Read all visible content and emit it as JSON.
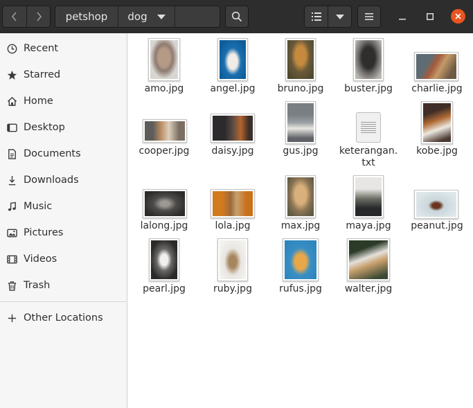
{
  "header": {
    "path": [
      "petshop",
      "dog"
    ],
    "colors": {
      "bar": "#2d2d2d",
      "close": "#e95420"
    }
  },
  "sidebar": {
    "items": [
      {
        "label": "Recent",
        "icon": "clock-icon"
      },
      {
        "label": "Starred",
        "icon": "star-icon"
      },
      {
        "label": "Home",
        "icon": "home-icon"
      },
      {
        "label": "Desktop",
        "icon": "desktop-icon"
      },
      {
        "label": "Documents",
        "icon": "document-icon"
      },
      {
        "label": "Downloads",
        "icon": "download-icon"
      },
      {
        "label": "Music",
        "icon": "music-icon"
      },
      {
        "label": "Pictures",
        "icon": "picture-icon"
      },
      {
        "label": "Videos",
        "icon": "video-icon"
      },
      {
        "label": "Trash",
        "icon": "trash-icon"
      }
    ],
    "other_locations": {
      "label": "Other Locations",
      "icon": "plus-icon"
    }
  },
  "files": [
    {
      "name": "amo.jpg"
    },
    {
      "name": "angel.jpg"
    },
    {
      "name": "bruno.jpg"
    },
    {
      "name": "buster.jpg"
    },
    {
      "name": "charlie.jpg"
    },
    {
      "name": "cooper.jpg"
    },
    {
      "name": "daisy.jpg"
    },
    {
      "name": "gus.jpg"
    },
    {
      "name": "keterangan.\ntxt"
    },
    {
      "name": "kobe.jpg"
    },
    {
      "name": "lalong.jpg"
    },
    {
      "name": "lola.jpg"
    },
    {
      "name": "max.jpg"
    },
    {
      "name": "maya.jpg"
    },
    {
      "name": "peanut.jpg"
    },
    {
      "name": "pearl.jpg"
    },
    {
      "name": "ruby.jpg"
    },
    {
      "name": "rufus.jpg"
    },
    {
      "name": "walter.jpg"
    }
  ]
}
